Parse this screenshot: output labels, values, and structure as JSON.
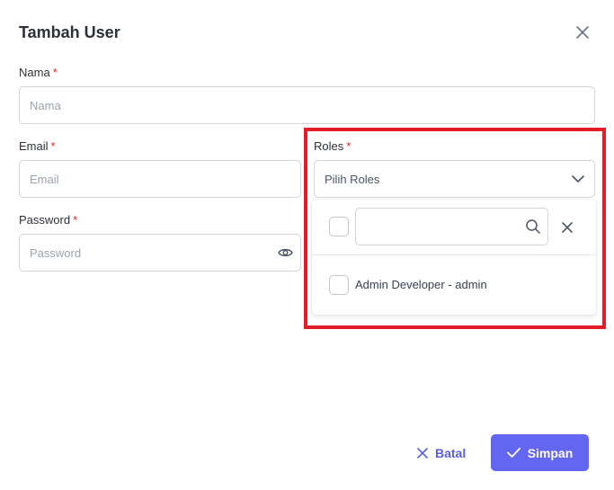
{
  "dialog": {
    "title": "Tambah User"
  },
  "form": {
    "required_mark": "*",
    "nama": {
      "label": "Nama",
      "placeholder": "Nama",
      "value": ""
    },
    "email": {
      "label": "Email",
      "placeholder": "Email",
      "value": ""
    },
    "password": {
      "label": "Password",
      "placeholder": "Password",
      "value": ""
    },
    "roles": {
      "label": "Roles",
      "selected_text": "Pilih Roles",
      "filter_value": "",
      "options": [
        {
          "label": "Admin Developer - admin",
          "checked": false
        }
      ]
    }
  },
  "footer": {
    "cancel_label": "Batal",
    "save_label": "Simpan"
  },
  "colors": {
    "accent": "#6366f1",
    "required": "#e02424",
    "highlight": "#e11d2a"
  },
  "icons": {
    "close": "close-icon",
    "eye": "eye-icon",
    "chevron": "chevron-down-icon",
    "search": "search-icon",
    "clear": "clear-icon",
    "cancel": "x-icon",
    "save": "check-icon"
  }
}
